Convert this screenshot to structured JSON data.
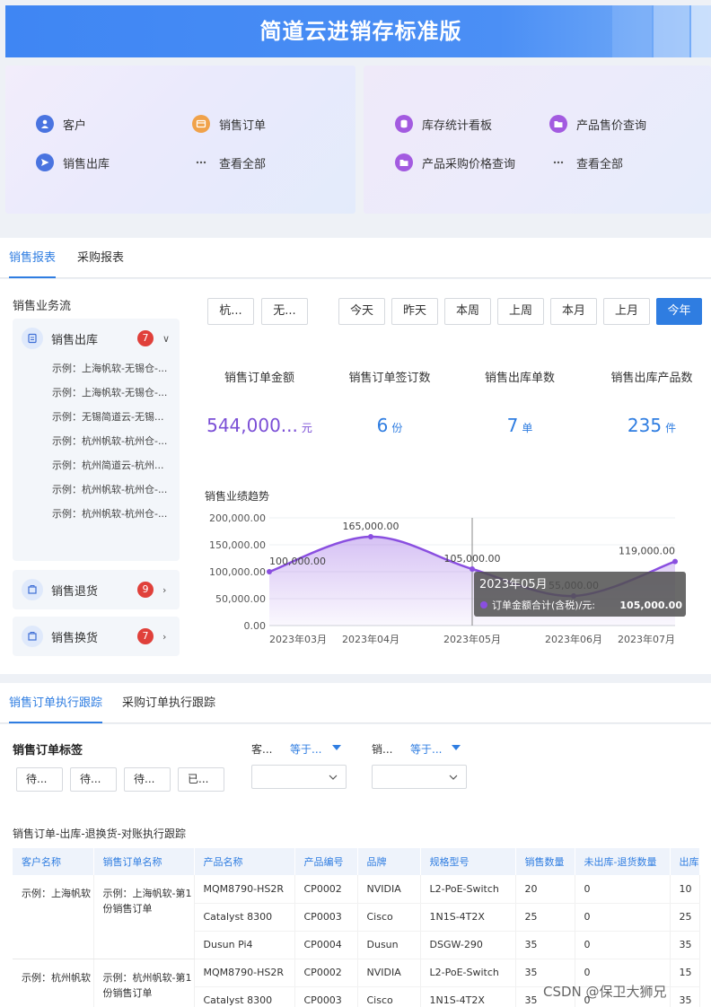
{
  "app": {
    "title": "简道云进销存标准版"
  },
  "quick_links": {
    "left": [
      {
        "label": "客户",
        "icon": "customer-icon",
        "color": "#4a74e0"
      },
      {
        "label": "销售订单",
        "icon": "order-icon",
        "color": "#f0a24a"
      },
      {
        "label": "销售出库",
        "icon": "outbound-icon",
        "color": "#4a74e0"
      },
      {
        "label": "查看全部",
        "icon": "more-icon",
        "color": "#666666"
      }
    ],
    "right": [
      {
        "label": "库存统计看板",
        "icon": "database-icon",
        "color": "#a35be0"
      },
      {
        "label": "产品售价查询",
        "icon": "folder-icon",
        "color": "#a35be0"
      },
      {
        "label": "产品采购价格查询",
        "icon": "folder-icon",
        "color": "#a35be0"
      },
      {
        "label": "查看全部",
        "icon": "more-icon",
        "color": "#666666"
      }
    ]
  },
  "report_tabs": {
    "sales": "销售报表",
    "purchase": "采购报表"
  },
  "flow": {
    "title": "销售业务流",
    "outbound": {
      "label": "销售出库",
      "count": "7",
      "items": [
        "示例：上海帆软-无锡仓-...",
        "示例：上海帆软-无锡仓-...",
        "示例：无锡简道云-无锡...",
        "示例：杭州帆软-杭州仓-...",
        "示例：杭州简道云-杭州...",
        "示例：杭州帆软-杭州仓-...",
        "示例：杭州帆软-杭州仓-..."
      ]
    },
    "returns": {
      "label": "销售退货",
      "count": "9"
    },
    "exchange": {
      "label": "销售换货",
      "count": "7"
    }
  },
  "filters": {
    "dropdowns": [
      "杭...",
      "无..."
    ],
    "periods": [
      "今天",
      "昨天",
      "本周",
      "上周",
      "本月",
      "上月",
      "今年"
    ],
    "active": "今年"
  },
  "kpis": [
    {
      "label": "销售订单金额",
      "value": "544,000...",
      "unit": "元",
      "color": "#7b4fd6"
    },
    {
      "label": "销售订单签订数",
      "value": "6",
      "unit": "份",
      "color": "#2f7de1"
    },
    {
      "label": "销售出库单数",
      "value": "7",
      "unit": "单",
      "color": "#2f7de1"
    },
    {
      "label": "销售出库产品数",
      "value": "235",
      "unit": "件",
      "color": "#2f7de1"
    }
  ],
  "chart_title": "销售业绩趋势",
  "chart_data": {
    "type": "area",
    "categories": [
      "2023年03月",
      "2023年04月",
      "2023年05月",
      "2023年06月",
      "2023年07月"
    ],
    "values": [
      100000,
      165000,
      105000,
      55000,
      119000
    ],
    "value_labels": [
      "100,000.00",
      "165,000.00",
      "105,000.00",
      "55,000.00",
      "119,000.00"
    ],
    "yticks": [
      "0.00",
      "50,000.00",
      "100,000.00",
      "150,000.00",
      "200,000.00"
    ],
    "ylim": [
      0,
      200000
    ],
    "color": "#8a4fe0",
    "tooltip": {
      "title": "2023年05月",
      "label": "订单金额合计(含税)/元:",
      "value": "105,000.00"
    }
  },
  "tracking_tabs": {
    "sales": "销售订单执行跟踪",
    "purchase": "采购订单执行跟踪"
  },
  "tracking": {
    "tags_title": "销售订单标签",
    "tags": [
      "待...",
      "待...",
      "待...",
      "已..."
    ],
    "filter1": {
      "label": "客...",
      "op": "等于..."
    },
    "filter2": {
      "label": "销...",
      "op": "等于..."
    }
  },
  "table": {
    "title": "销售订单-出库-退换货-对账执行跟踪",
    "columns": [
      "客户名称",
      "销售订单名称",
      "产品名称",
      "产品编号",
      "品牌",
      "规格型号",
      "销售数量",
      "未出库-退货数量",
      "出库"
    ],
    "groups": [
      {
        "customer": "示例：上海帆软",
        "order": "示例：上海帆软-第1份销售订单",
        "rows": [
          [
            "MQM8790-HS2R",
            "CP0002",
            "NVIDIA",
            "L2-PoE-Switch",
            "20",
            "0",
            "10"
          ],
          [
            "Catalyst 8300",
            "CP0003",
            "Cisco",
            "1N1S-4T2X",
            "25",
            "0",
            "25"
          ],
          [
            "Dusun Pi4",
            "CP0004",
            "Dusun",
            "DSGW-290",
            "35",
            "0",
            "35"
          ]
        ]
      },
      {
        "customer": "示例：杭州帆软",
        "order": "示例：杭州帆软-第1份销售订单",
        "rows": [
          [
            "MQM8790-HS2R",
            "CP0002",
            "NVIDIA",
            "L2-PoE-Switch",
            "35",
            "0",
            "15"
          ],
          [
            "Catalyst 8300",
            "CP0003",
            "Cisco",
            "1N1S-4T2X",
            "35",
            "0",
            "35"
          ]
        ]
      }
    ]
  },
  "watermark": "CSDN @保卫大狮兄"
}
